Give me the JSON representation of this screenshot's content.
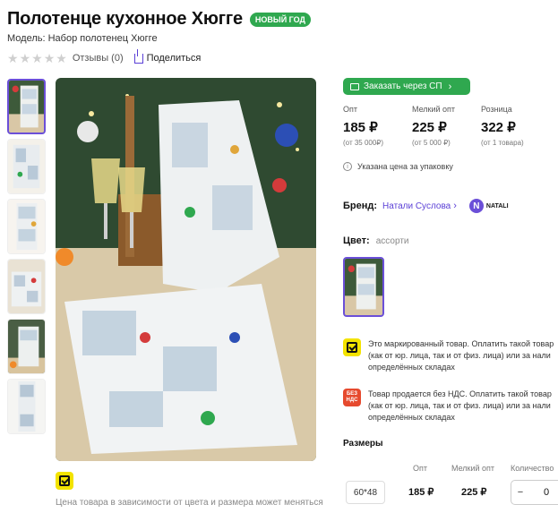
{
  "product": {
    "title": "Полотенце кухонное Хюгге",
    "badge": "НОВЫЙ ГОД",
    "model": "Модель: Набор полотенец Хюгге"
  },
  "rating": {
    "stars": 0,
    "max_stars": 5,
    "reviews": "Отзывы (0)",
    "share": "Поделиться"
  },
  "gallery": {
    "thumbnail_count": 6,
    "active_index": 0
  },
  "marker_note": "Цена товара в зависимости от цвета и размера может меняться",
  "order_button": "Заказать через СП",
  "prices": [
    {
      "label": "Опт",
      "value": "185 ₽",
      "sub": "(от 35 000₽)"
    },
    {
      "label": "Мелкий опт",
      "value": "225 ₽",
      "sub": "(от 5 000 ₽)"
    },
    {
      "label": "Розница",
      "value": "322 ₽",
      "sub": "(от 1 товара)"
    }
  ],
  "package_note": "Указана цена за упаковку",
  "brand": {
    "label": "Бренд:",
    "name": "Натали Суслова",
    "logo_text": "NATALI"
  },
  "color": {
    "label": "Цвет:",
    "value": "ассорти"
  },
  "notices": {
    "marked": [
      "Это маркированный товар. Оплатить такой товар",
      "(как от юр. лица, так и от физ. лица) или за нали",
      "определённых складах"
    ],
    "vat_icon": "БЕЗ НДС",
    "vat": [
      "Товар продается без НДС. Оплатить такой товар",
      "(как от юр. лица, так и от физ. лица) или за нали",
      "определённых складах"
    ]
  },
  "sizes": {
    "title": "Размеры",
    "headers": {
      "opt": "Опт",
      "small_opt": "Мелкий опт",
      "qty": "Количество"
    },
    "rows": [
      {
        "size": "60*48",
        "opt": "185 ₽",
        "small_opt": "225 ₽",
        "qty": "0",
        "minus": "−"
      }
    ]
  },
  "colors": {
    "accent": "#2fa84f",
    "brand": "#6b4fd8",
    "marker": "#f3e300",
    "vat": "#e64a2e"
  }
}
